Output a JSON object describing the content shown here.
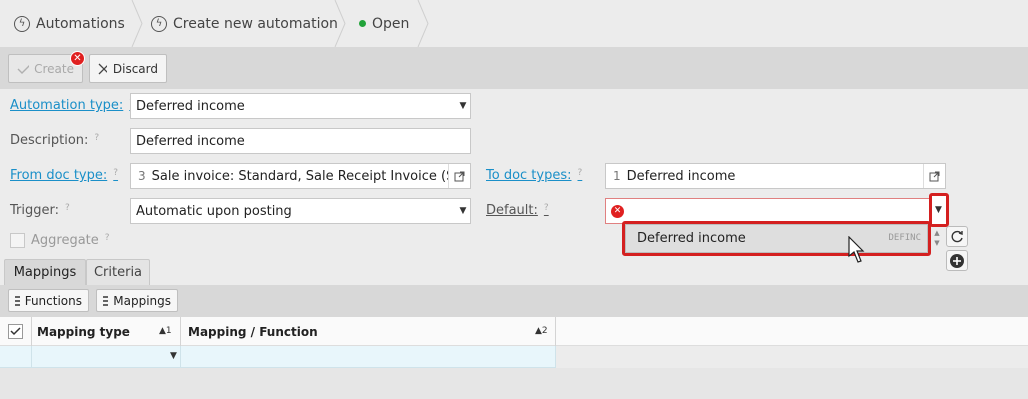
{
  "breadcrumb": {
    "items": [
      {
        "label": "Automations",
        "icon": "lightning-icon"
      },
      {
        "label": "Create new automation",
        "icon": "lightning-icon"
      },
      {
        "label": "Open",
        "icon": "status-dot-icon"
      }
    ],
    "status_color": "#22a33a"
  },
  "toolbar": {
    "create_label": "Create",
    "discard_label": "Discard"
  },
  "form": {
    "automation_type": {
      "label": "Automation type:",
      "value": "Deferred income"
    },
    "description": {
      "label": "Description:",
      "value": "Deferred income"
    },
    "from_doc_type": {
      "label": "From doc type:",
      "count": "3",
      "value": "Sale invoice: Standard, Sale Receipt Invoice (SRI), Sa"
    },
    "to_doc_types": {
      "label": "To doc types:",
      "count": "1",
      "value": "Deferred income"
    },
    "trigger": {
      "label": "Trigger:",
      "value": "Automatic upon posting"
    },
    "default": {
      "label": "Default:",
      "value": ""
    },
    "aggregate": {
      "label": "Aggregate",
      "checked": false
    },
    "help_mark": "?"
  },
  "dropdown": {
    "option_label": "Deferred income",
    "option_code": "DEFINC"
  },
  "tabs": [
    {
      "label": "Mappings",
      "active": true
    },
    {
      "label": "Criteria",
      "active": false
    }
  ],
  "grid": {
    "functions_label": "Functions",
    "mappings_label": "Mappings",
    "columns": [
      {
        "label": "Mapping type",
        "sort": "▲1"
      },
      {
        "label": "Mapping / Function",
        "sort": "▲2"
      }
    ]
  },
  "colors": {
    "accent_link": "#1a8fc8",
    "error_red": "#d42020"
  }
}
